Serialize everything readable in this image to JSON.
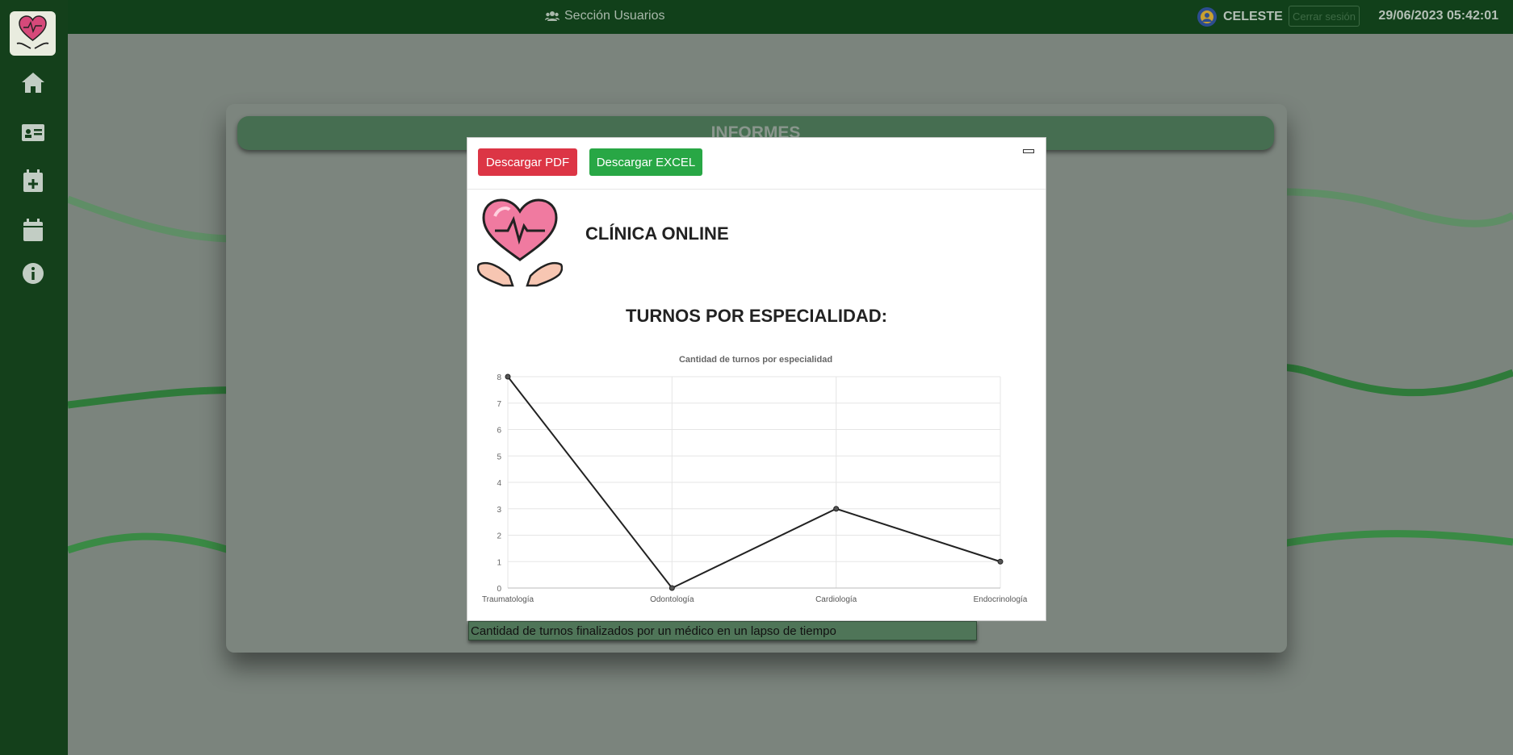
{
  "topbar": {
    "section_label": "Sección Usuarios",
    "user_name": "CELESTE",
    "logout_label": "Cerrar sesión",
    "datetime": "29/06/2023 05:42:01"
  },
  "sidebar": {
    "items": [
      {
        "icon": "home-icon"
      },
      {
        "icon": "id-card-icon"
      },
      {
        "icon": "calendar-plus-icon"
      },
      {
        "icon": "calendar-icon"
      },
      {
        "icon": "info-icon"
      }
    ]
  },
  "panel": {
    "title": "INFORMES",
    "report_item": "Cantidad de turnos finalizados por un médico en un lapso de tiempo"
  },
  "modal": {
    "pdf_label": "Descargar PDF",
    "excel_label": "Descargar EXCEL",
    "clinic_name": "CLÍNICA ONLINE",
    "report_title": "TURNOS POR ESPECIALIDAD:"
  },
  "colors": {
    "pdf_button": "#dc3545",
    "excel_button": "#28a745",
    "sidebar": "#14401b"
  },
  "chart_data": {
    "type": "line",
    "title": "Cantidad de turnos por especialidad",
    "categories": [
      "Traumatología",
      "Odontología",
      "Cardiología",
      "Endocrinología"
    ],
    "values": [
      8,
      0,
      3,
      1
    ],
    "ylim": [
      0,
      8
    ],
    "yticks": [
      0,
      1,
      2,
      3,
      4,
      5,
      6,
      7,
      8
    ],
    "grid": true
  }
}
